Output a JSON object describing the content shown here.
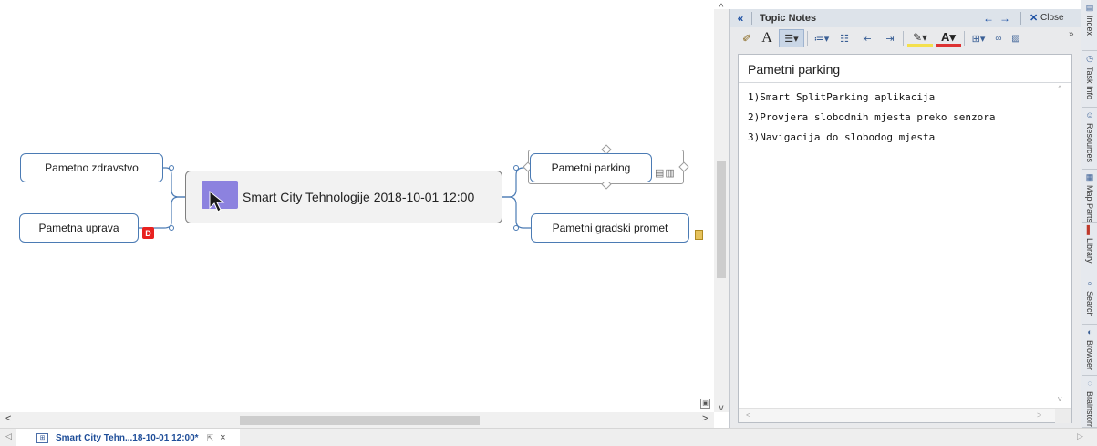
{
  "canvas": {
    "central_topic": {
      "label": "Smart City Tehnologije 2018-10-01 12:00",
      "image_color": "#8c82df"
    },
    "left_topics": [
      {
        "label": "Pametno zdravstvo"
      },
      {
        "label": "Pametna uprava",
        "badge": "D"
      }
    ],
    "right_topics": [
      {
        "label": "Pametni parking",
        "selected": true
      },
      {
        "label": "Pametni gradski promet"
      }
    ],
    "connector_color": "#4b7bb4",
    "scroll": {
      "up": "^",
      "down": "v",
      "left": "<",
      "right": ">"
    }
  },
  "tabbar": {
    "doc_tab_label": "Smart City Tehn...18-10-01 12:00*",
    "close": "×"
  },
  "notes": {
    "header_title": "Topic Notes",
    "collapse": "«",
    "back": "←",
    "forward": "→",
    "close_x": "✕",
    "close_label": "Close",
    "more": "»",
    "topic_title": "Pametni parking",
    "lines": [
      "1)Smart SplitParking aplikacija",
      "2)Provjera slobodnih mjesta preko senzora",
      "3)Navigacija do slobodog mjesta"
    ],
    "toolbar": {
      "font_glyph": "A",
      "color_glyph": "A"
    }
  },
  "side_tabs": [
    {
      "label": "Index",
      "icon": "index-icon"
    },
    {
      "label": "Task Info",
      "icon": "task-info-icon"
    },
    {
      "label": "Resources",
      "icon": "resources-icon"
    },
    {
      "label": "Map Parts",
      "icon": "map-parts-icon"
    },
    {
      "label": "Library",
      "icon": "library-icon"
    },
    {
      "label": "Search",
      "icon": "search-icon"
    },
    {
      "label": "Browser",
      "icon": "browser-icon"
    },
    {
      "label": "Brainstorm",
      "icon": "brainstorm-icon"
    }
  ]
}
